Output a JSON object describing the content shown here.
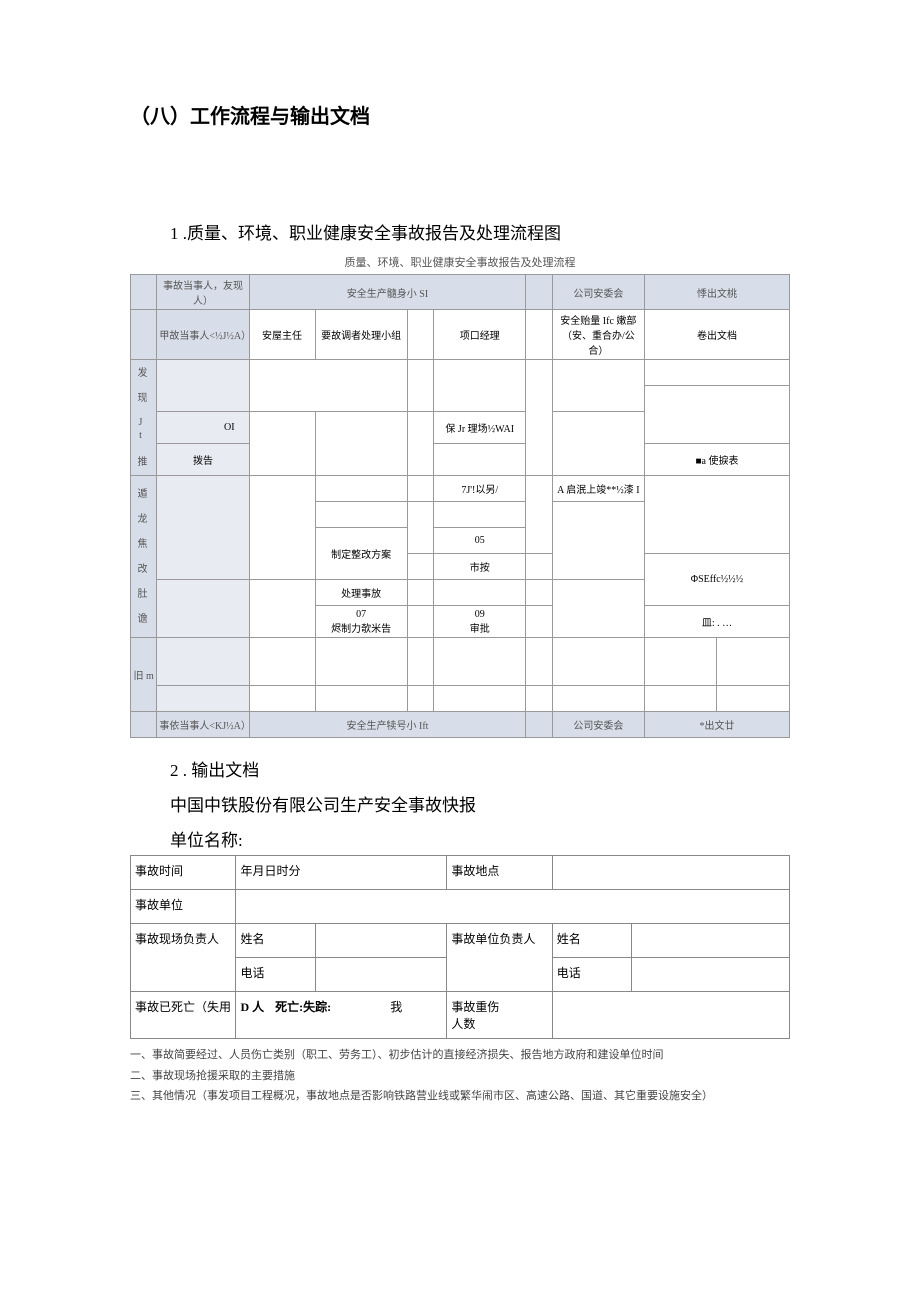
{
  "heading_main": "（八）工作流程与输出文档",
  "heading_sub1": "1 .质量、环境、职业健康安全事故报告及处理流程图",
  "flow_caption": "质量、环境、职业健康安全事故报告及处理流程",
  "flow": {
    "top_headers": [
      "事故当事人，友现人）",
      "安全生产髓身小 SI",
      "公司安委会",
      "悸出文桃"
    ],
    "sub_headers": [
      "甲故当事人<½J½A）",
      "安屋主任",
      "要故调者处理小组",
      "项口经理",
      "安全贻量 Ifc 嫩部（安、重合办/公合）",
      "卷出文档"
    ],
    "row_labels": [
      "发 现 Jt 推",
      "遁 龙 焦 改 肚 谵",
      "旧 m"
    ],
    "cells": {
      "ol": "OI",
      "baogao": "拨告",
      "bao_jr": "保 Jr 理场½WAI",
      "a_shibiao": "■a 使捩表",
      "7j": "7J'!以另/",
      "a_qimu": "A 启泯上竣**½漆 I",
      "zhiding": "制定整改方案",
      "05": "05",
      "shitou": "市按",
      "phi": "ΦSEffc½½½",
      "chuli": "处理事放",
      "07": "07",
      "xianzhi": "烬制力欹米告",
      "09": "09",
      "shenpi": "审批",
      "min": "皿: . …"
    },
    "bottom_headers": [
      "事依当事人<KJ½A）",
      "安全生产犊号小 Ift",
      "公司安委会",
      "*出文廿"
    ]
  },
  "heading_sub2": "2 . 输出文档",
  "output_title": "中国中铁股份有限公司生产安全事故快报",
  "unit_label": "单位名称:",
  "form": {
    "r1c1": "事故时间",
    "r1c2": "年月日时分",
    "r1c3": "事故地点",
    "r2c1": "事故单位",
    "r3c1": "事故现场负责人",
    "r3c2": "姓名",
    "r3c3": "事故单位负责人",
    "r3c4": "姓名",
    "r4c2": "电话",
    "r4c4": "电话",
    "r5c1": "事故已死亡（失用",
    "r5c2a": "D 人",
    "r5c2b": "我",
    "r5c2c": "死亡:失踪:",
    "r5c3": "事故重伤\n人数"
  },
  "notes": [
    "一、事故简要经过、人员伤亡类别（职工、劳务工）、初步估计的直接经济损失、报告地方政府和建设单位时间",
    "二、事故现场抢援采取的主要措施",
    "三、其他情况（事发项目工程概况，事故地点是否影响铁路营业线或繁华闹市区、高速公路、国道、其它重要设施安全）"
  ]
}
